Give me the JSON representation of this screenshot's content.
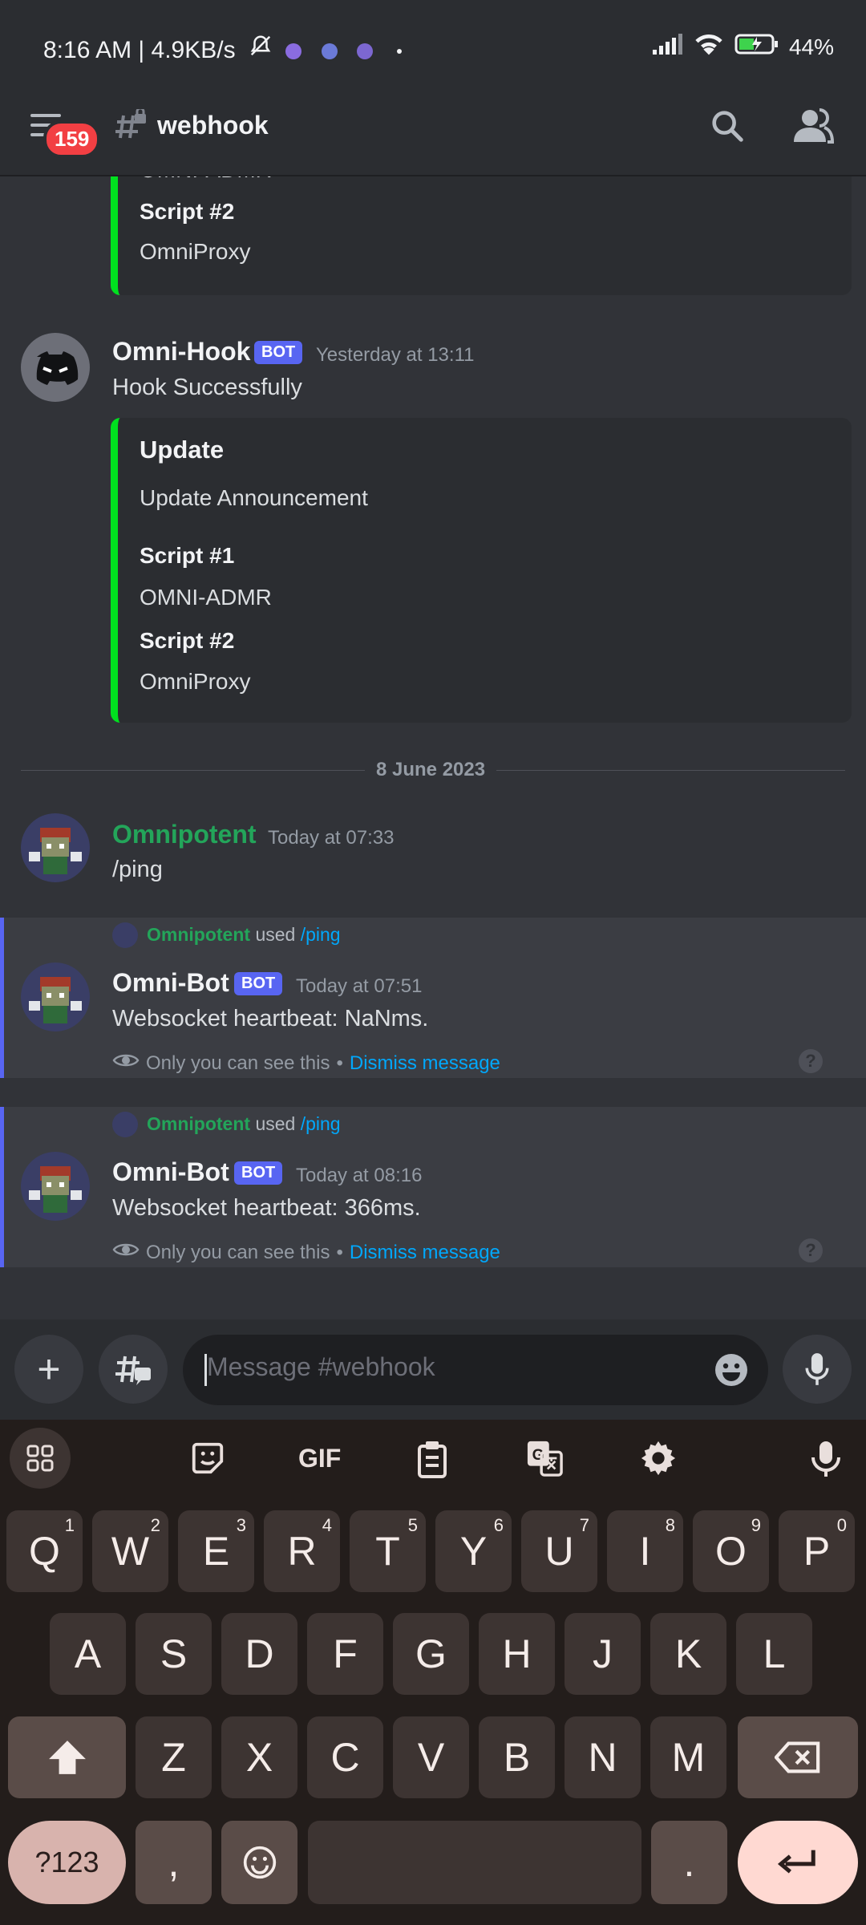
{
  "status": {
    "time_speed": "8:16 AM | 4.9KB/s",
    "battery": "44%"
  },
  "header": {
    "unread_count": "159",
    "channel_name": "webhook"
  },
  "messages": [
    {
      "author": "Omni-Hook",
      "badge": "BOT",
      "time": "Yesterday at 13:11",
      "text": "Hook Successfully",
      "embed": {
        "title": "Update",
        "description": "Update Announcement",
        "fields": [
          {
            "name": "Script #1",
            "value": "OMNI-ADMR"
          },
          {
            "name": "Script #2",
            "value": "OmniProxy"
          }
        ]
      }
    }
  ],
  "previous_embed_tail": {
    "partial_value": "OMNI-ADMR",
    "field_name": "Script #2",
    "field_value": "OmniProxy"
  },
  "date_divider": "8 June 2023",
  "user_message": {
    "author": "Omnipotent",
    "time": "Today at 07:33",
    "text": "/ping"
  },
  "ephemeral": [
    {
      "used_by": "Omnipotent",
      "used_word": "used",
      "command": "/ping",
      "author": "Omni-Bot",
      "badge": "BOT",
      "time": "Today at 07:51",
      "text": "Websocket heartbeat: NaNms.",
      "only_you": "Only you can see this",
      "sep": "•",
      "dismiss": "Dismiss message",
      "help": "?"
    },
    {
      "used_by": "Omnipotent",
      "used_word": "used",
      "command": "/ping",
      "author": "Omni-Bot",
      "badge": "BOT",
      "time": "Today at 08:16",
      "text": "Websocket heartbeat: 366ms.",
      "only_you": "Only you can see this",
      "sep": "•",
      "dismiss": "Dismiss message",
      "help": "?"
    }
  ],
  "composer": {
    "placeholder": "Message #webhook",
    "plus": "+"
  },
  "keyboard": {
    "toolbar": {
      "gif": "GIF"
    },
    "row1": [
      {
        "k": "Q",
        "n": "1"
      },
      {
        "k": "W",
        "n": "2"
      },
      {
        "k": "E",
        "n": "3"
      },
      {
        "k": "R",
        "n": "4"
      },
      {
        "k": "T",
        "n": "5"
      },
      {
        "k": "Y",
        "n": "6"
      },
      {
        "k": "U",
        "n": "7"
      },
      {
        "k": "I",
        "n": "8"
      },
      {
        "k": "O",
        "n": "9"
      },
      {
        "k": "P",
        "n": "0"
      }
    ],
    "row2": [
      "A",
      "S",
      "D",
      "F",
      "G",
      "H",
      "J",
      "K",
      "L"
    ],
    "row3": [
      "Z",
      "X",
      "C",
      "V",
      "B",
      "N",
      "M"
    ],
    "symbols": "?123",
    "comma": ",",
    "period": "."
  },
  "colors": {
    "background": "#313338",
    "embed_accent": "#00e01f",
    "bot_badge": "#5865f2",
    "link": "#00a8fc",
    "username_green": "#23a55a"
  }
}
